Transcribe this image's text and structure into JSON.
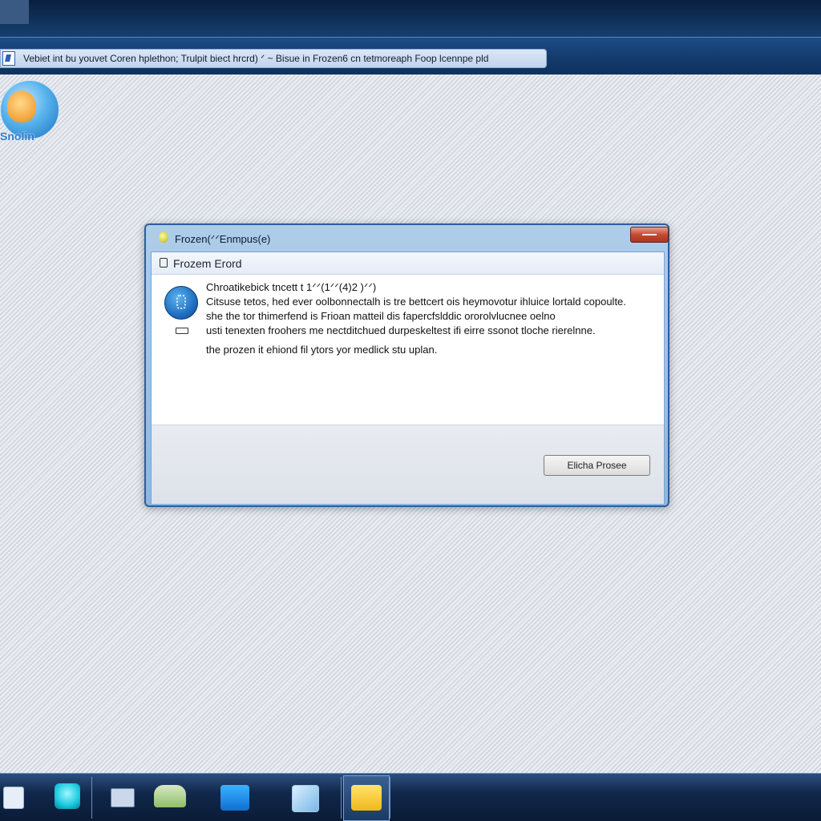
{
  "window": {
    "title": "Vebiet int bu youvet Coren hplethon; Trulpit biect hrcrd) ᐟ ~ Bisue in Frozen6 cn tetmoreaph   Foop lcennpe pld"
  },
  "desktop": {
    "icon_label": "Snolin"
  },
  "dialog": {
    "title": "Frozen(ᐟᐟEnmpus(e)",
    "header": "Frozem Erord",
    "message_line1": "Chroatikebick tncett t 1ᐟᐟ(1ᐟᐟ(4)2 )ᐟᐟ)",
    "message_line2": "Citsuse tetos, hed ever oolbonnectalh is tre bettcert ois heymovotur ihluice lortald copoulte.",
    "message_line3": "she the tor thimerfend is Frioan matteil dis fapercfslddic ororolvlucnee oelno",
    "message_line4": "usti tenexten froohers me nectditchued durpeskeltest ifi eirre ssonot tloche rierelnne.",
    "message_line5": "the prozen it ehiond fil ytors yor medlick stu uplan.",
    "button_label": "Elicha Prosee"
  },
  "taskbar": {
    "items": [
      "start",
      "app-1",
      "app-2",
      "app-3",
      "app-4",
      "app-5",
      "app-6"
    ]
  }
}
